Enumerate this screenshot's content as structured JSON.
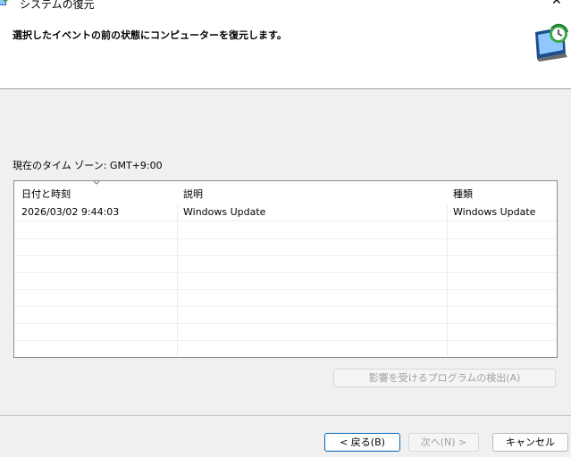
{
  "window": {
    "title": "システムの復元",
    "close_glyph": "✕"
  },
  "header": {
    "instruction": "選択したイベントの前の状態にコンピューターを復元します。"
  },
  "timezone_label": "現在のタイム ゾーン: GMT+9:00",
  "list": {
    "columns": [
      "日付と時刻",
      "説明",
      "種類"
    ],
    "rows": [
      {
        "datetime": "2026/03/02 9:44:03",
        "description": "Windows Update",
        "type": "Windows Update"
      }
    ]
  },
  "buttons": {
    "scan_affected": "影響を受けるプログラムの検出(A)",
    "back": "< 戻る(B)",
    "next": "次へ(N) >",
    "cancel": "キャンセル"
  },
  "colors": {
    "accent": "#0067c0",
    "disabled_text": "#a0a0a0"
  }
}
